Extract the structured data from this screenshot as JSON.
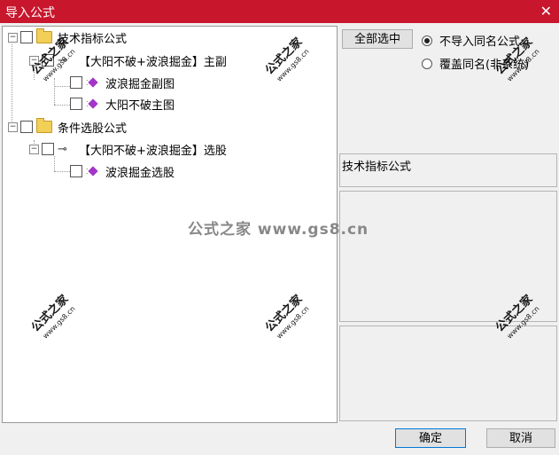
{
  "window": {
    "title": "导入公式",
    "close_glyph": "✕"
  },
  "tree": {
    "nodes": [
      {
        "label": "技术指标公式"
      },
      {
        "label": "【大阳不破+波浪掘金】主副"
      },
      {
        "label": "波浪掘金副图"
      },
      {
        "label": "大阳不破主图"
      },
      {
        "label": "条件选股公式"
      },
      {
        "label": "【大阳不破+波浪掘金】选股"
      },
      {
        "label": "波浪掘金选股"
      }
    ]
  },
  "right": {
    "select_all": "全部选中",
    "radio_skip": "不导入同名公式",
    "radio_overwrite": "覆盖同名(非系统)",
    "category_label": "技术指标公式"
  },
  "buttons": {
    "ok": "确定",
    "cancel": "取消"
  },
  "watermark": {
    "brand": "公式之家",
    "url": "www.gs8.cn",
    "center": "公式之家 www.gs8.cn"
  }
}
